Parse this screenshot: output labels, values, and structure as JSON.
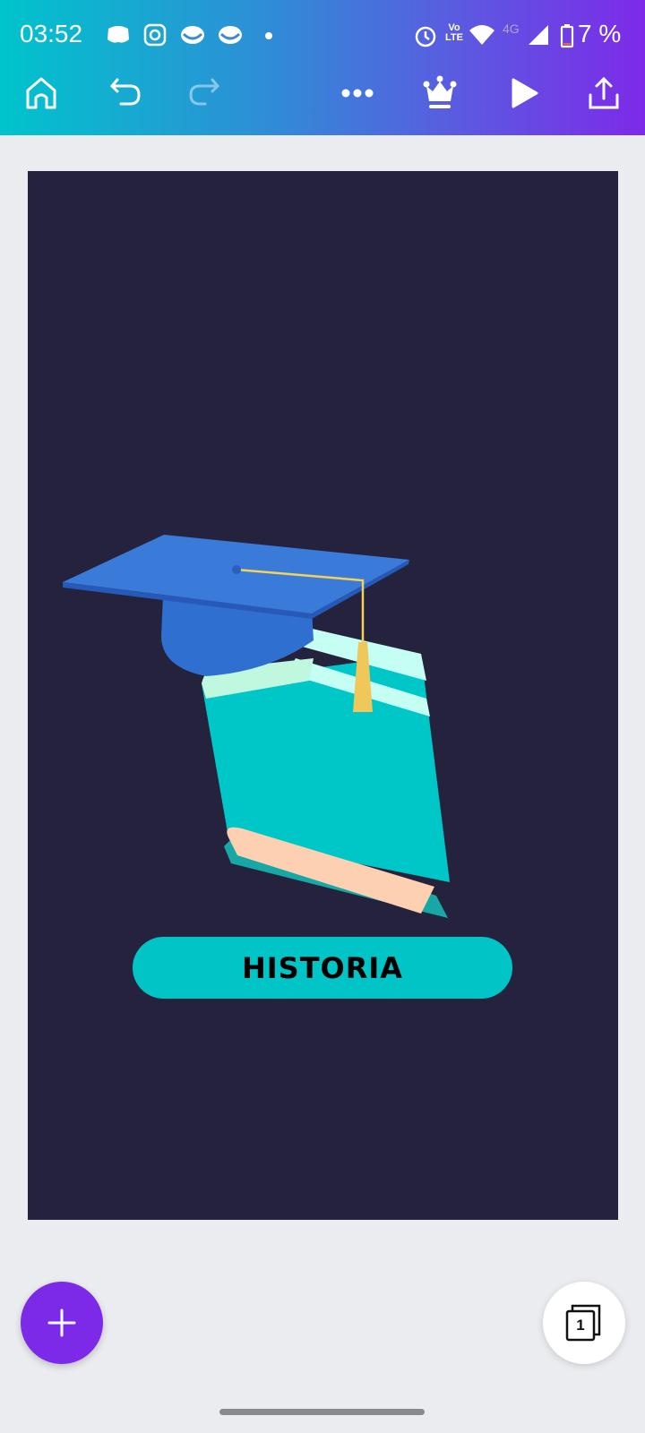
{
  "status_bar": {
    "time": "03:52",
    "network": "4G",
    "volte": "Vo LTE",
    "battery": "7 %",
    "icons": [
      "discord-icon",
      "instagram-icon",
      "messenger-icon",
      "messenger-icon",
      "dot-icon",
      "alarm-icon",
      "wifi-icon",
      "signal-icon",
      "battery-icon"
    ]
  },
  "toolbar": {
    "icons": [
      "home-icon",
      "undo-icon",
      "redo-icon",
      "more-icon",
      "crown-icon",
      "play-icon",
      "share-icon"
    ]
  },
  "design": {
    "background": "#25223d",
    "button_label": "HISTORIA",
    "button_color": "#00c4c6"
  },
  "page_count": "1",
  "colors": {
    "accent": "#7d2ae8",
    "gradient_start": "#00c4cc"
  }
}
